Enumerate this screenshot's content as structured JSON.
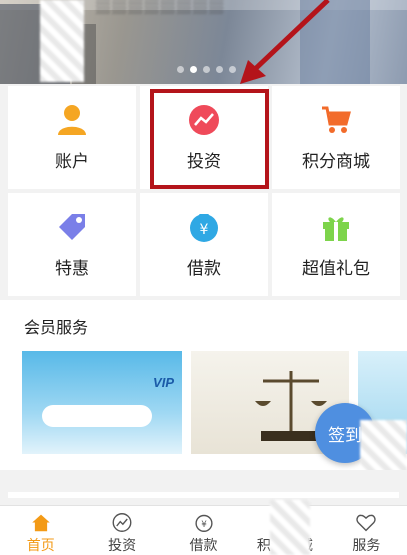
{
  "banner": {
    "dots": 5,
    "active_dot": 1
  },
  "grid": [
    {
      "name": "account",
      "label": "账户",
      "icon": "person-icon",
      "color": "#f5a623"
    },
    {
      "name": "invest",
      "label": "投资",
      "icon": "trend-up-icon",
      "color": "#ef4a5a"
    },
    {
      "name": "points-mall",
      "label": "积分商城",
      "icon": "cart-icon",
      "color": "#f26b2a"
    },
    {
      "name": "specials",
      "label": "特惠",
      "icon": "price-tag-icon",
      "color": "#7a7fe8"
    },
    {
      "name": "loan",
      "label": "借款",
      "icon": "money-bag-icon",
      "color": "#2fa8e4"
    },
    {
      "name": "gift-pack",
      "label": "超值礼包",
      "icon": "gift-icon",
      "color": "#7dd44b"
    }
  ],
  "member_services": {
    "title": "会员服务"
  },
  "checkin": {
    "label": "签到"
  },
  "nav": [
    {
      "label": "首页",
      "icon": "home-icon",
      "active": true
    },
    {
      "label": "投资",
      "icon": "invest-icon",
      "active": false
    },
    {
      "label": "借款",
      "icon": "loan-icon",
      "active": false
    },
    {
      "label": "积分商城",
      "icon": "store-icon",
      "active": false
    },
    {
      "label": "服务",
      "icon": "heart-icon",
      "active": false
    }
  ],
  "colors": {
    "accent": "#f39a16",
    "highlight_border": "#b4141a",
    "checkin_button": "#4f8fe0"
  }
}
